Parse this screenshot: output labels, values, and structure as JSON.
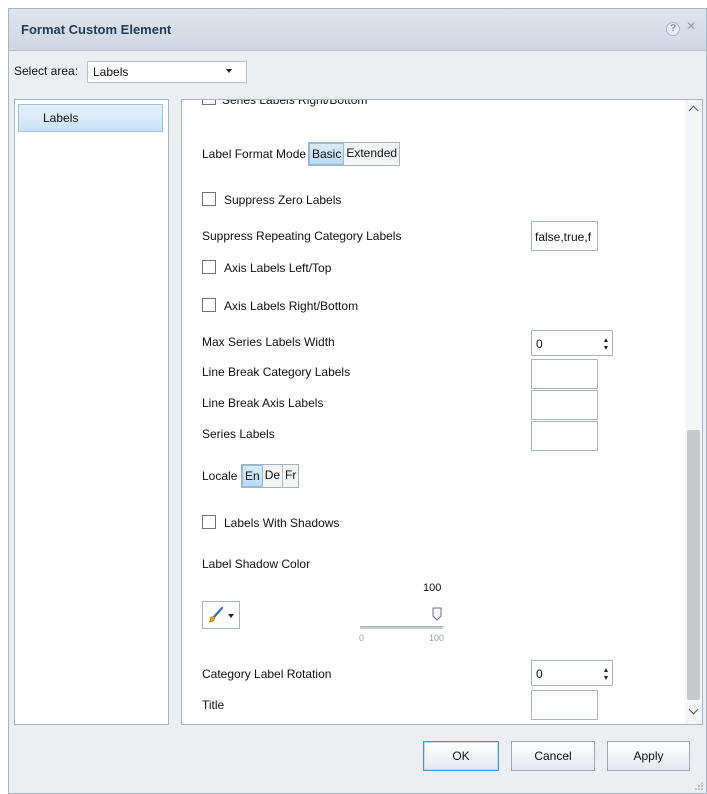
{
  "dialog": {
    "title": "Format Custom Element",
    "help_icon": "?",
    "close_icon": "×"
  },
  "area": {
    "label": "Select area:",
    "selected": "Labels"
  },
  "left_panel": {
    "items": [
      {
        "label": "Labels"
      }
    ]
  },
  "settings": {
    "cut_off_item": "Series Labels Right/Bottom",
    "label_format_mode": {
      "label": "Label Format Mode",
      "options": [
        "Basic",
        "Extended"
      ],
      "active": "Basic"
    },
    "suppress_zero_labels": {
      "label": "Suppress Zero Labels",
      "checked": false
    },
    "suppress_repeating": {
      "label": "Suppress Repeating Category Labels",
      "value": "false,true,f"
    },
    "axis_left_top": {
      "label": "Axis Labels Left/Top",
      "checked": false
    },
    "axis_right_bottom": {
      "label": "Axis Labels Right/Bottom",
      "checked": false
    },
    "max_series_width": {
      "label": "Max Series Labels Width",
      "value": "0"
    },
    "line_break_category": {
      "label": "Line Break Category Labels",
      "value": ""
    },
    "line_break_axis": {
      "label": "Line Break Axis Labels",
      "value": ""
    },
    "series_labels": {
      "label": "Series Labels",
      "value": ""
    },
    "locale": {
      "label": "Locale",
      "options": [
        "En",
        "De",
        "Fr"
      ],
      "active": "En"
    },
    "labels_with_shadows": {
      "label": "Labels With Shadows",
      "checked": false
    },
    "label_shadow_color": {
      "label": "Label Shadow Color",
      "brush_color": "#e8a400",
      "opacity": {
        "value": "100",
        "min": "0",
        "max": "100",
        "level_fraction": 1.0
      }
    },
    "category_label_rotation": {
      "label": "Category Label Rotation",
      "value": "0"
    },
    "title": {
      "label": "Title",
      "value": ""
    }
  },
  "footer": {
    "ok": "OK",
    "cancel": "Cancel",
    "apply": "Apply"
  },
  "colors": {
    "title_text": "#233a5a",
    "selection": "#c9e2f6",
    "primary_border": "#4f8fcf"
  }
}
